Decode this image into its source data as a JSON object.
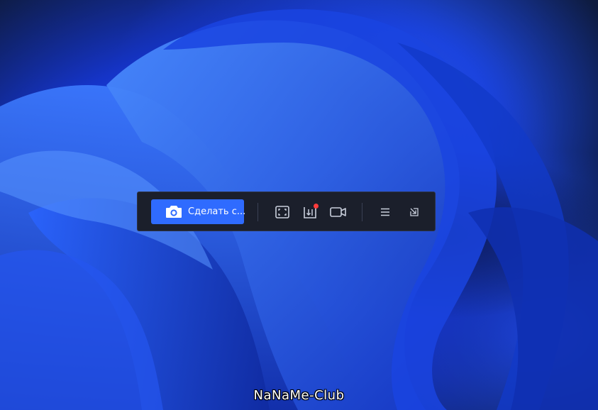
{
  "toolbar": {
    "capture_label": "Сделать с...",
    "icons": {
      "capture": "camera-icon",
      "region": "fullscreen-frame-icon",
      "scrolling": "scrolling-capture-icon",
      "record": "video-camera-icon",
      "menu": "menu-icon",
      "collapse": "collapse-icon"
    }
  },
  "watermark": {
    "text": "NaNaMe-Club"
  },
  "colors": {
    "accent": "#2f6bff",
    "toolbar_bg": "#1b1f2b",
    "icon": "#c9cfdc",
    "badge": "#ff3b3b"
  }
}
